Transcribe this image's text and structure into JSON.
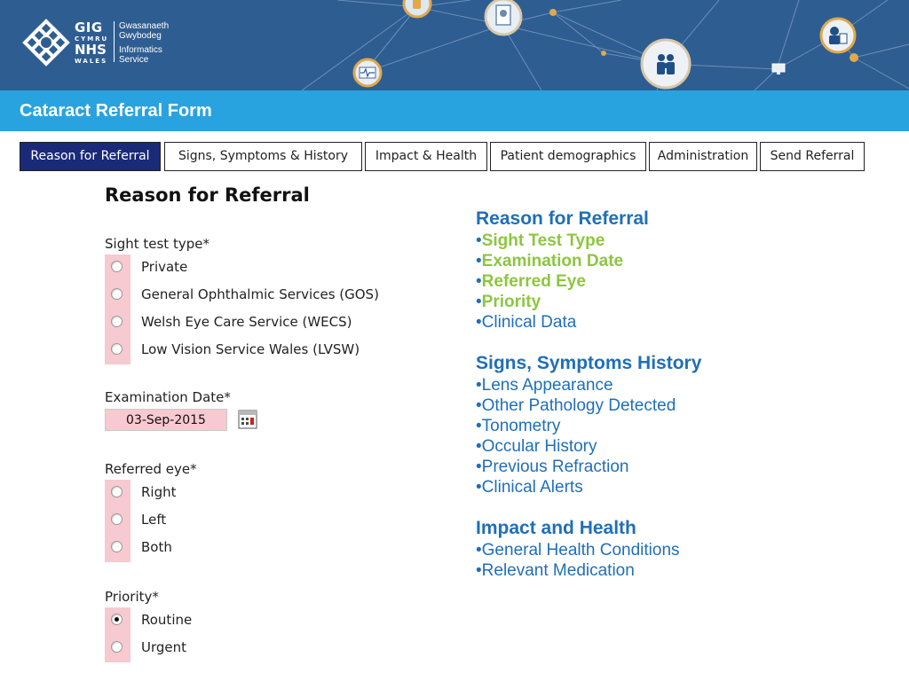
{
  "header": {
    "logo": {
      "gig": "GIG",
      "cymru": "CYMRU",
      "nhs": "NHS",
      "wales": "WALES",
      "service_line1": "Gwasanaeth",
      "service_line2": "Gwybodeg",
      "service_line3": "Informatics",
      "service_line4": "Service"
    },
    "banner_color": "#2e5d92",
    "icons": [
      "phone-icon",
      "document-icon",
      "ecg-monitor-icon",
      "doctor-icon",
      "family-icon",
      "medical-report-icon",
      "monitor-icon"
    ]
  },
  "titlebar": {
    "title": "Cataract Referral Form",
    "color": "#29a3e0"
  },
  "tabs": [
    {
      "label": "Reason for Referral",
      "active": true
    },
    {
      "label": "Signs, Symptoms & History",
      "active": false
    },
    {
      "label": "Impact & Health",
      "active": false
    },
    {
      "label": "Patient demographics",
      "active": false
    },
    {
      "label": "Administration",
      "active": false
    },
    {
      "label": "Send Referral",
      "active": false
    }
  ],
  "form": {
    "heading": "Reason for Referral",
    "sight_test": {
      "label": "Sight test type*",
      "options": [
        "Private",
        "General Ophthalmic Services (GOS)",
        "Welsh Eye Care Service (WECS)",
        "Low Vision Service Wales (LVSW)"
      ],
      "selected": null
    },
    "exam_date": {
      "label": "Examination Date*",
      "value": "03-Sep-2015"
    },
    "referred_eye": {
      "label": "Referred eye*",
      "options": [
        "Right",
        "Left",
        "Both"
      ],
      "selected": null
    },
    "priority": {
      "label": "Priority*",
      "options": [
        "Routine",
        "Urgent"
      ],
      "selected": "Routine"
    },
    "required_color": "#f7c9d0"
  },
  "summary": {
    "bullet": "•",
    "sections": [
      {
        "heading": "Reason for Referral",
        "items": [
          {
            "text": "Sight Test Type",
            "done": true
          },
          {
            "text": "Examination Date",
            "done": true
          },
          {
            "text": "Referred Eye",
            "done": true
          },
          {
            "text": "Priority",
            "done": true
          },
          {
            "text": "Clinical Data",
            "done": false
          }
        ]
      },
      {
        "heading": "Signs, Symptoms History",
        "items": [
          {
            "text": "Lens Appearance",
            "done": false
          },
          {
            "text": "Other Pathology Detected",
            "done": false
          },
          {
            "text": "Tonometry",
            "done": false
          },
          {
            "text": "Occular History",
            "done": false
          },
          {
            "text": "Previous Refraction",
            "done": false
          },
          {
            "text": "Clinical Alerts",
            "done": false
          }
        ]
      },
      {
        "heading": "Impact and Health",
        "items": [
          {
            "text": "General Health Conditions",
            "done": false
          },
          {
            "text": "Relevant Medication",
            "done": false
          }
        ]
      }
    ],
    "heading_color": "#1f6fb8",
    "done_color": "#8cc63f"
  }
}
